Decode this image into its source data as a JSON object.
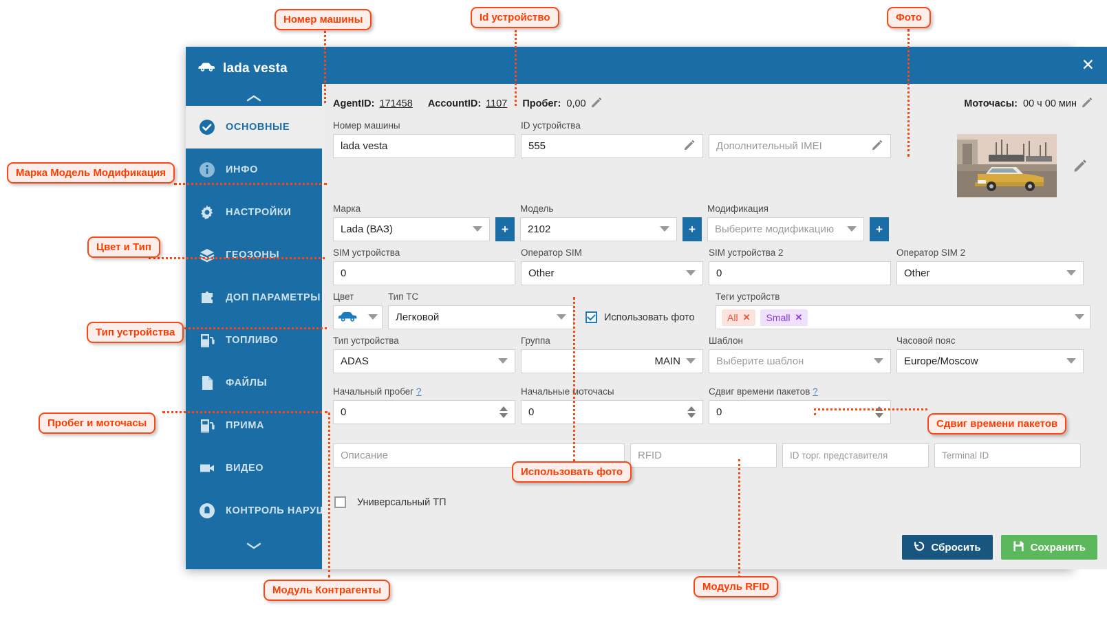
{
  "window": {
    "title": "lada vesta",
    "close_label": "✕"
  },
  "sidebar": {
    "items": [
      {
        "label": "ОСНОВНЫЕ",
        "icon": "check-circle-icon",
        "active": true
      },
      {
        "label": "ИНФО",
        "icon": "info-circle-icon",
        "active": false
      },
      {
        "label": "НАСТРОЙКИ",
        "icon": "gear-icon",
        "active": false
      },
      {
        "label": "ГЕОЗОНЫ",
        "icon": "layers-icon",
        "active": false
      },
      {
        "label": "ДОП ПАРАМЕТРЫ",
        "icon": "puzzle-icon",
        "active": false
      },
      {
        "label": "ТОПЛИВО",
        "icon": "fuel-pump-icon",
        "active": false
      },
      {
        "label": "ФАЙЛЫ",
        "icon": "file-icon",
        "active": false
      },
      {
        "label": "ПРИМА",
        "icon": "fuel-pump-icon",
        "active": false
      },
      {
        "label": "ВИДЕО",
        "icon": "video-camera-icon",
        "active": false
      },
      {
        "label": "КОНТРОЛЬ НАРУШЕН...",
        "icon": "alert-circle-icon",
        "active": false
      }
    ]
  },
  "idstrip": {
    "agent_id_label": "AgentID:",
    "agent_id_value": "171458",
    "account_id_label": "AccountID:",
    "account_id_value": "1107",
    "mileage_label": "Пробег:",
    "mileage_value": "0,00",
    "enginehours_label": "Моточасы:",
    "enginehours_value": "00 ч 00 мин"
  },
  "form": {
    "vehicle_number": {
      "label": "Номер машины",
      "value": "lada vesta"
    },
    "device_id": {
      "label": "ID устройства",
      "value": "555"
    },
    "extra_imei": {
      "label": "",
      "placeholder": "Дополнительный IMEI",
      "value": ""
    },
    "brand": {
      "label": "Марка",
      "value": "Lada (ВАЗ)",
      "add": "+"
    },
    "model": {
      "label": "Модель",
      "value": "2102",
      "add": "+"
    },
    "modification": {
      "label": "Модификация",
      "placeholder": "Выберите модификацию",
      "value": "",
      "add": "+"
    },
    "sim1": {
      "label": "SIM устройства",
      "value": "0"
    },
    "sim_operator1": {
      "label": "Оператор SIM",
      "value": "Other"
    },
    "sim2": {
      "label": "SIM устройства 2",
      "value": "0"
    },
    "sim_operator2": {
      "label": "Оператор SIM 2",
      "value": "Other"
    },
    "color": {
      "label": "Цвет",
      "value": "car-blue-icon"
    },
    "vehicle_type": {
      "label": "Тип ТС",
      "value": "Легковой"
    },
    "use_photo": {
      "label": "Использовать фото",
      "checked": true
    },
    "device_tags": {
      "label": "Теги устройств",
      "tags": [
        {
          "text": "All",
          "color": "#e8523a"
        },
        {
          "text": "Small",
          "color": "#8b3ddb"
        }
      ]
    },
    "device_type": {
      "label": "Тип устройства",
      "value": "ADAS"
    },
    "group": {
      "label": "Группа",
      "value": "MAIN"
    },
    "template": {
      "label": "Шаблон",
      "placeholder": "Выберите шаблон",
      "value": ""
    },
    "timezone": {
      "label": "Часовой пояс",
      "value": "Europe/Moscow"
    },
    "initial_mileage": {
      "label": "Начальный пробег",
      "hint": "?",
      "value": "0"
    },
    "initial_enginehours": {
      "label": "Начальные моточасы",
      "hint": "",
      "value": "0"
    },
    "packet_time_shift": {
      "label": "Сдвиг времени пакетов",
      "hint": "?",
      "value": "0"
    },
    "description": {
      "placeholder": "Описание",
      "value": ""
    },
    "rfid": {
      "placeholder": "RFID",
      "value": ""
    },
    "dealer_id": {
      "placeholder": "ID торг. представителя",
      "value": ""
    },
    "terminal_id": {
      "placeholder": "Terminal ID",
      "value": ""
    },
    "universal_tp": {
      "label": "Универсальный ТП",
      "checked": false
    }
  },
  "footer": {
    "reset_label": "Сбросить",
    "save_label": "Сохранить"
  },
  "annotations": [
    {
      "id": "a-number",
      "text": "Номер машины"
    },
    {
      "id": "a-deviceid",
      "text": "Id устройство"
    },
    {
      "id": "a-photo",
      "text": "Фото"
    },
    {
      "id": "a-brand",
      "text": "Марка Модель Модификация"
    },
    {
      "id": "a-color",
      "text": "Цвет и Тип"
    },
    {
      "id": "a-devtype",
      "text": "Тип устройства"
    },
    {
      "id": "a-mileage",
      "text": "Пробег  и моточасы"
    },
    {
      "id": "a-usephoto",
      "text": "Использовать фото"
    },
    {
      "id": "a-shift",
      "text": "Сдвиг времени пакетов"
    },
    {
      "id": "a-contr",
      "text": "Модуль  Контрагенты"
    },
    {
      "id": "a-rfid",
      "text": "Модуль RFID"
    }
  ],
  "colors": {
    "brand_blue": "#1a6ea5",
    "accent_orange": "#ff4612",
    "save_green": "#5cb85c",
    "reset_blue": "#18557f"
  }
}
